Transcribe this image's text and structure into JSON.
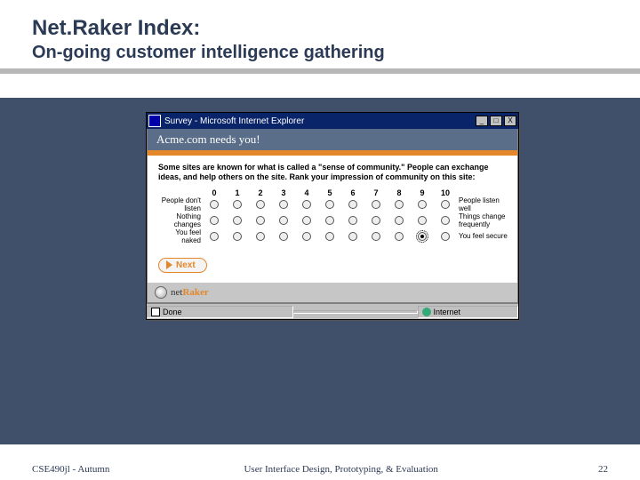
{
  "slide": {
    "title": "Net.Raker Index:",
    "subtitle": "On-going customer intelligence gathering"
  },
  "browser": {
    "window_title": "Survey - Microsoft Internet Explorer",
    "controls": {
      "min": "_",
      "max": "□",
      "close": "X"
    },
    "banner": "Acme.com needs you!",
    "prompt": "Some sites are known for what is called a \"sense of community.\" People can exchange ideas, and help others on the site. Rank your impression of community on this site:",
    "scale": [
      "0",
      "1",
      "2",
      "3",
      "4",
      "5",
      "6",
      "7",
      "8",
      "9",
      "10"
    ],
    "rows": [
      {
        "left": "People don't listen",
        "right": "People listen well",
        "selected": null
      },
      {
        "left": "Nothing changes",
        "right": "Things change frequently",
        "selected": null
      },
      {
        "left": "You feel naked",
        "right": "You feel secure",
        "selected": 9
      }
    ],
    "next_label": "Next",
    "brand_net": "net",
    "brand_raker": "Raker",
    "status_done": "Done",
    "status_zone": "Internet"
  },
  "footer": {
    "left": "CSE490jl - Autumn",
    "center": "User Interface Design, Prototyping, & Evaluation",
    "page": "22"
  }
}
